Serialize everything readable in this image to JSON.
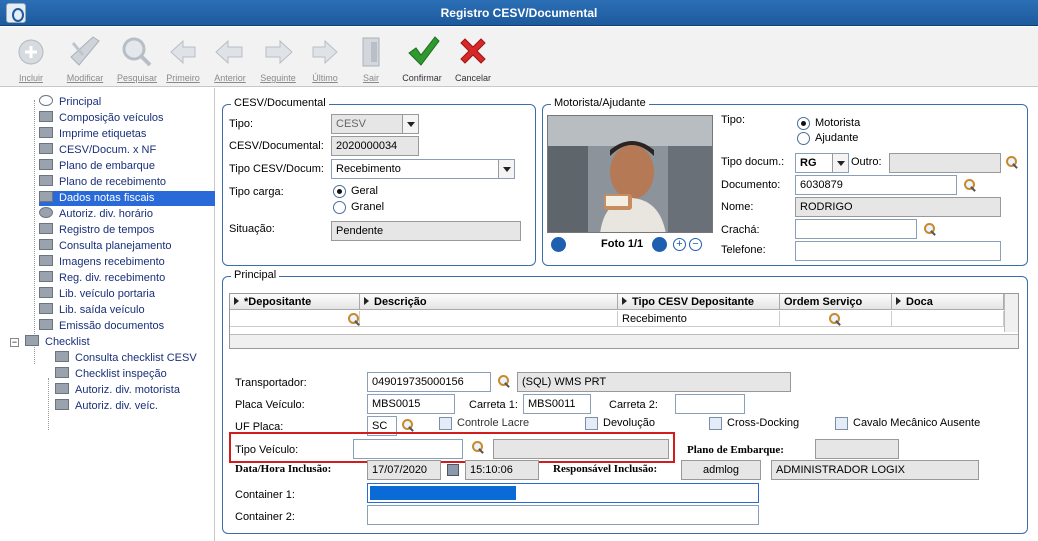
{
  "window": {
    "title": "Registro CESV/Documental"
  },
  "toolbar": [
    {
      "label": "Incluir",
      "icon": "add-icon",
      "enabled": false
    },
    {
      "label": "Modificar",
      "icon": "edit-icon",
      "enabled": false
    },
    {
      "label": "Pesquisar",
      "icon": "search-icon",
      "enabled": false
    },
    {
      "label": "Primeiro",
      "icon": "first-icon",
      "enabled": false
    },
    {
      "label": "Anterior",
      "icon": "previous-icon",
      "enabled": false
    },
    {
      "label": "Seguinte",
      "icon": "next-icon",
      "enabled": false
    },
    {
      "label": "Último",
      "icon": "last-icon",
      "enabled": false
    },
    {
      "label": "Sair",
      "icon": "exit-icon",
      "enabled": false
    },
    {
      "label": "Confirmar",
      "icon": "confirm-icon",
      "enabled": true
    },
    {
      "label": "Cancelar",
      "icon": "cancel-icon",
      "enabled": true
    }
  ],
  "tree": {
    "items": [
      "Principal",
      "Composição veículos",
      "Imprime etiquetas",
      "CESV/Docum. x NF",
      "Plano de embarque",
      "Plano de recebimento",
      "Dados notas fiscais",
      "Autoriz. div. horário",
      "Registro de tempos",
      "Consulta planejamento",
      "Imagens recebimento",
      "Reg. div. recebimento",
      "Lib. veículo portaria",
      "Lib. saída veículo",
      "Emissão documentos",
      "Checklist",
      "Consulta checklist CESV",
      "Checklist inspeção",
      "Autoriz. div. motorista",
      "Autoriz. div. veíc."
    ],
    "selected": "Dados notas fiscais"
  },
  "cesv": {
    "legend": "CESV/Documental",
    "tipo_label": "Tipo:",
    "tipo_value": "CESV",
    "cesv_label": "CESV/Documental:",
    "cesv_value": "2020000034",
    "tipocesv_label": "Tipo CESV/Docum:",
    "tipocesv_value": "Recebimento",
    "carga_label": "Tipo carga:",
    "carga_opt1": "Geral",
    "carga_opt2": "Granel",
    "situacao_label": "Situação:",
    "situacao_value": "Pendente"
  },
  "motorista": {
    "legend": "Motorista/Ajudante",
    "tipo_label": "Tipo:",
    "opt1": "Motorista",
    "opt2": "Ajudante",
    "tipodoc_label": "Tipo docum.:",
    "tipodoc_value": "RG",
    "outro_label": "Outro:",
    "documento_label": "Documento:",
    "documento_value": "6030879",
    "nome_label": "Nome:",
    "nome_value": "RODRIGO",
    "cracha_label": "Crachá:",
    "telefone_label": "Telefone:",
    "foto_label": "Foto 1/1"
  },
  "principal": {
    "legend": "Principal",
    "grid_headers": [
      "*Depositante",
      "Descrição",
      "Tipo CESV Depositante",
      "Ordem Serviço",
      "Doca"
    ],
    "grid_row": {
      "tipo": "Recebimento"
    },
    "transportador_label": "Transportador:",
    "transportador_value": "049019735000156",
    "transportador_name": "(SQL) WMS PRT",
    "placa_label": "Placa Veículo:",
    "placa_value": "MBS0015",
    "carreta1_label": "Carreta 1:",
    "carreta1_value": "MBS0011",
    "carreta2_label": "Carreta 2:",
    "uf_label": "UF Placa:",
    "uf_value": "SC",
    "lacre_label": "Controle Lacre",
    "devolucao_label": "Devolução",
    "crossdock_label": "Cross-Docking",
    "cavalo_label": "Cavalo Mecânico Ausente",
    "tipoveiculo_label": "Tipo Veículo:",
    "plano_label": "Plano de Embarque:",
    "datahora_label": "Data/Hora Inclusão:",
    "data_value": "17/07/2020",
    "hora_value": "15:10:06",
    "resp_label": "Responsável Inclusão:",
    "resp_user": "admlog",
    "resp_name": "ADMINISTRADOR LOGIX",
    "container1_label": "Container 1:",
    "container2_label": "Container 2:"
  },
  "colors": {
    "titlebar": "#2c6fb5",
    "selection": "#2a6ad8",
    "highlight_box": "#d11d1d",
    "confirm": "#2e9a2e",
    "cancel": "#d62828"
  }
}
